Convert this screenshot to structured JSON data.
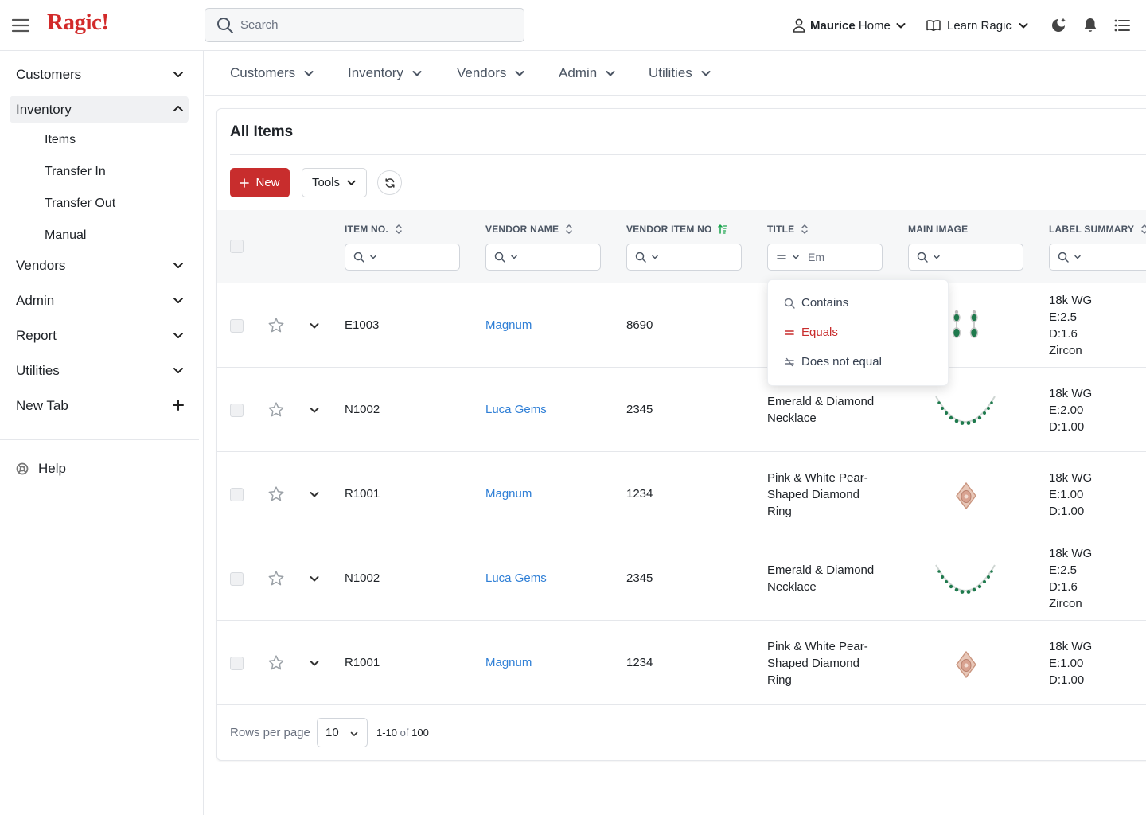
{
  "app": {
    "logo": "Ragic!"
  },
  "colors": {
    "brand": "#d22a2a",
    "link": "#2f7fd6",
    "sort_active": "#16a34a"
  },
  "topbar": {
    "search_placeholder": "Search",
    "user_first": "Maurice",
    "user_rest": "Home",
    "learn_label": "Learn Ragic"
  },
  "sidebar": {
    "items": [
      {
        "label": "Customers"
      },
      {
        "label": "Inventory"
      },
      {
        "label": "Vendors"
      },
      {
        "label": "Admin"
      },
      {
        "label": "Report"
      },
      {
        "label": "Utilities"
      },
      {
        "label": "New Tab"
      }
    ],
    "inventory_sub": [
      "Items",
      "Transfer In",
      "Transfer Out",
      "Manual"
    ],
    "help_label": "Help"
  },
  "tabs": [
    "Customers",
    "Inventory",
    "Vendors",
    "Admin",
    "Utilities"
  ],
  "page": {
    "title": "All Items"
  },
  "toolbar": {
    "new_label": "New",
    "tools_label": "Tools"
  },
  "table": {
    "columns": [
      "ITEM NO.",
      "VENDOR NAME",
      "VENDOR ITEM NO",
      "TITLE",
      "MAIN IMAGE",
      "LABEL SUMMARY"
    ],
    "title_filter_value": "Em",
    "rows": [
      {
        "item_no": "E1003",
        "vendor": "Magnum",
        "vendor_item_no": "8690",
        "title": "",
        "image": "earrings",
        "label": [
          "18k WG",
          "E:2.5",
          "D:1.6",
          "Zircon"
        ]
      },
      {
        "item_no": "N1002",
        "vendor": "Luca Gems",
        "vendor_item_no": "2345",
        "title": [
          "Emerald & Diamond",
          "Necklace"
        ],
        "image": "necklace",
        "label": [
          "18k WG",
          "E:2.00",
          "D:1.00"
        ]
      },
      {
        "item_no": "R1001",
        "vendor": "Magnum",
        "vendor_item_no": "1234",
        "title": [
          "Pink & White Pear-",
          "Shaped Diamond",
          "Ring"
        ],
        "image": "ring",
        "label": [
          "18k WG",
          "E:1.00",
          "D:1.00"
        ]
      },
      {
        "item_no": "N1002",
        "vendor": "Luca Gems",
        "vendor_item_no": "2345",
        "title": [
          "Emerald & Diamond",
          "Necklace"
        ],
        "image": "necklace",
        "label": [
          "18k WG",
          "E:2.5",
          "D:1.6",
          "Zircon"
        ]
      },
      {
        "item_no": "R1001",
        "vendor": "Magnum",
        "vendor_item_no": "1234",
        "title": [
          "Pink & White Pear-",
          "Shaped Diamond",
          "Ring"
        ],
        "image": "ring",
        "label": [
          "18k WG",
          "E:1.00",
          "D:1.00"
        ]
      }
    ]
  },
  "filter_menu": {
    "options": [
      "Contains",
      "Equals",
      "Does not equal"
    ],
    "selected": "Equals"
  },
  "pagination": {
    "rows_per_page_label": "Rows per page",
    "rows_per_page": "10",
    "range": "1-10",
    "of": "of",
    "total": "100"
  }
}
